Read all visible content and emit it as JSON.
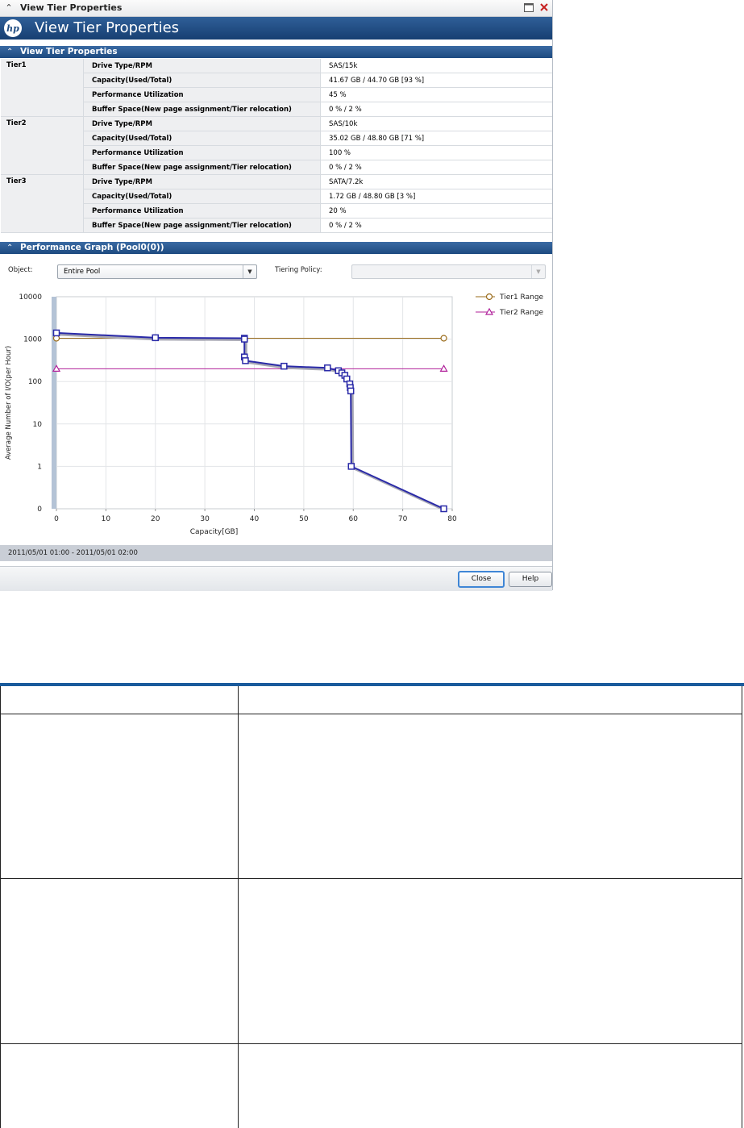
{
  "window": {
    "title": "View Tier Properties",
    "banner_title": "View Tier Properties"
  },
  "properties_section": {
    "title": "View Tier Properties",
    "tiers": [
      {
        "name": "Tier1",
        "rows": [
          {
            "label": "Drive Type/RPM",
            "value": "SAS/15k"
          },
          {
            "label": "Capacity(Used/Total)",
            "value": "41.67 GB / 44.70 GB [93 %]"
          },
          {
            "label": "Performance Utilization",
            "value": "45 %"
          },
          {
            "label": "Buffer Space(New page assignment/Tier relocation)",
            "value": "0 % / 2 %"
          }
        ]
      },
      {
        "name": "Tier2",
        "rows": [
          {
            "label": "Drive Type/RPM",
            "value": "SAS/10k"
          },
          {
            "label": "Capacity(Used/Total)",
            "value": "35.02 GB / 48.80 GB [71 %]"
          },
          {
            "label": "Performance Utilization",
            "value": "100 %"
          },
          {
            "label": "Buffer Space(New page assignment/Tier relocation)",
            "value": "0 % / 2 %"
          }
        ]
      },
      {
        "name": "Tier3",
        "rows": [
          {
            "label": "Drive Type/RPM",
            "value": "SATA/7.2k"
          },
          {
            "label": "Capacity(Used/Total)",
            "value": "1.72 GB / 48.80 GB [3 %]"
          },
          {
            "label": "Performance Utilization",
            "value": "20 %"
          },
          {
            "label": "Buffer Space(New page assignment/Tier relocation)",
            "value": "0 % / 2 %"
          }
        ]
      }
    ]
  },
  "graph_section": {
    "title": "Performance Graph (Pool0(0))",
    "object_label": "Object:",
    "object_value": "Entire Pool",
    "tiering_label": "Tiering Policy:",
    "tiering_value": ""
  },
  "chart_data": {
    "type": "line",
    "xlabel": "Capacity[GB]",
    "ylabel": "Average Number of I/O(per Hour)",
    "x_ticks": [
      "0",
      "10",
      "20",
      "30",
      "40",
      "50",
      "60",
      "70",
      "80"
    ],
    "y_ticks": [
      "0",
      "1",
      "10",
      "100",
      "1000",
      "10000"
    ],
    "xlim": [
      0,
      80
    ],
    "ylim": [
      0,
      10000
    ],
    "y_scale": "log",
    "grid": true,
    "legend_position": "right",
    "series": [
      {
        "name": "",
        "color": "#2a2aa8",
        "marker": "square",
        "points": [
          [
            0,
            1400
          ],
          [
            20,
            1080
          ],
          [
            38,
            1050
          ],
          [
            38,
            1000
          ],
          [
            38,
            380
          ],
          [
            38.2,
            310
          ],
          [
            46,
            230
          ],
          [
            54.8,
            210
          ],
          [
            57,
            180
          ],
          [
            57.7,
            160
          ],
          [
            58.3,
            140
          ],
          [
            58.7,
            115
          ],
          [
            59.3,
            88
          ],
          [
            59.4,
            72
          ],
          [
            59.5,
            60
          ],
          [
            59.6,
            1
          ],
          [
            78.3,
            0
          ]
        ]
      },
      {
        "name": "Tier1 Range",
        "color": "#9a6b1a",
        "marker": "circle",
        "points": [
          [
            0,
            1050
          ],
          [
            78.3,
            1050
          ]
        ]
      },
      {
        "name": "Tier2 Range",
        "color": "#b0209a",
        "marker": "triangle",
        "points": [
          [
            0,
            200
          ],
          [
            78.3,
            200
          ]
        ]
      }
    ]
  },
  "status": {
    "time_range": "2011/05/01 01:00 - 2011/05/01 02:00"
  },
  "buttons": {
    "close": "Close",
    "help": "Help"
  }
}
